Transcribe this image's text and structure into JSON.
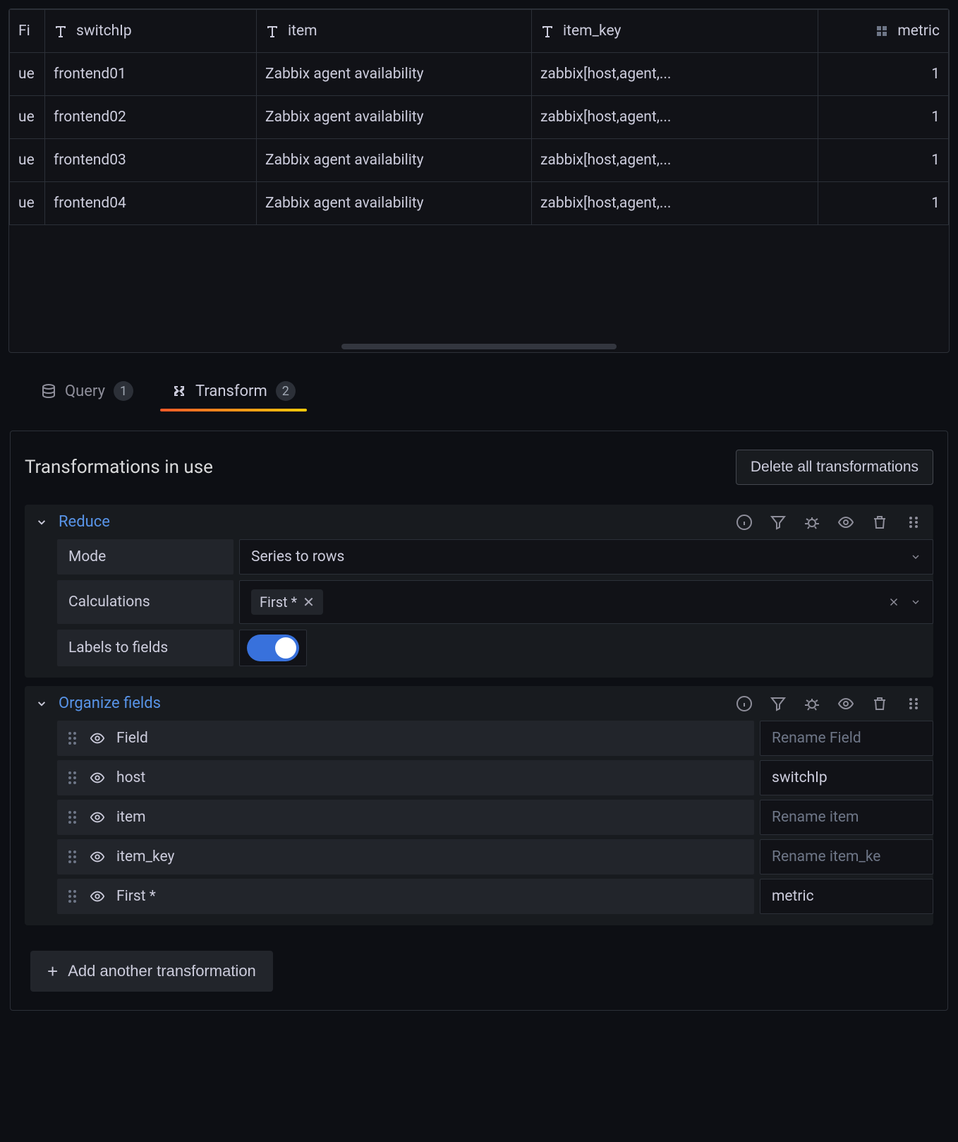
{
  "table": {
    "headers": {
      "fi": "Fi",
      "switchip": "switchIp",
      "item": "item",
      "item_key": "item_key",
      "metric": "metric"
    },
    "rows": [
      {
        "ue": "ue",
        "switchip": "frontend01",
        "item": "Zabbix agent availability",
        "item_key": "zabbix[host,agent,...",
        "metric": "1"
      },
      {
        "ue": "ue",
        "switchip": "frontend02",
        "item": "Zabbix agent availability",
        "item_key": "zabbix[host,agent,...",
        "metric": "1"
      },
      {
        "ue": "ue",
        "switchip": "frontend03",
        "item": "Zabbix agent availability",
        "item_key": "zabbix[host,agent,...",
        "metric": "1"
      },
      {
        "ue": "ue",
        "switchip": "frontend04",
        "item": "Zabbix agent availability",
        "item_key": "zabbix[host,agent,...",
        "metric": "1"
      }
    ]
  },
  "tabs": {
    "query": {
      "label": "Query",
      "count": "1"
    },
    "transform": {
      "label": "Transform",
      "count": "2"
    }
  },
  "section": {
    "title": "Transformations in use",
    "delete_all": "Delete all transformations",
    "add_another": "Add another transformation"
  },
  "reduce": {
    "title": "Reduce",
    "mode_label": "Mode",
    "mode_value": "Series to rows",
    "calc_label": "Calculations",
    "calc_chip": "First *",
    "labels_to_fields": "Labels to fields"
  },
  "organize": {
    "title": "Organize fields",
    "fields": [
      {
        "name": "Field",
        "rename": "",
        "placeholder": "Rename Field"
      },
      {
        "name": "host",
        "rename": "switchIp",
        "placeholder": ""
      },
      {
        "name": "item",
        "rename": "",
        "placeholder": "Rename item"
      },
      {
        "name": "item_key",
        "rename": "",
        "placeholder": "Rename item_ke"
      },
      {
        "name": "First *",
        "rename": "metric",
        "placeholder": ""
      }
    ]
  }
}
